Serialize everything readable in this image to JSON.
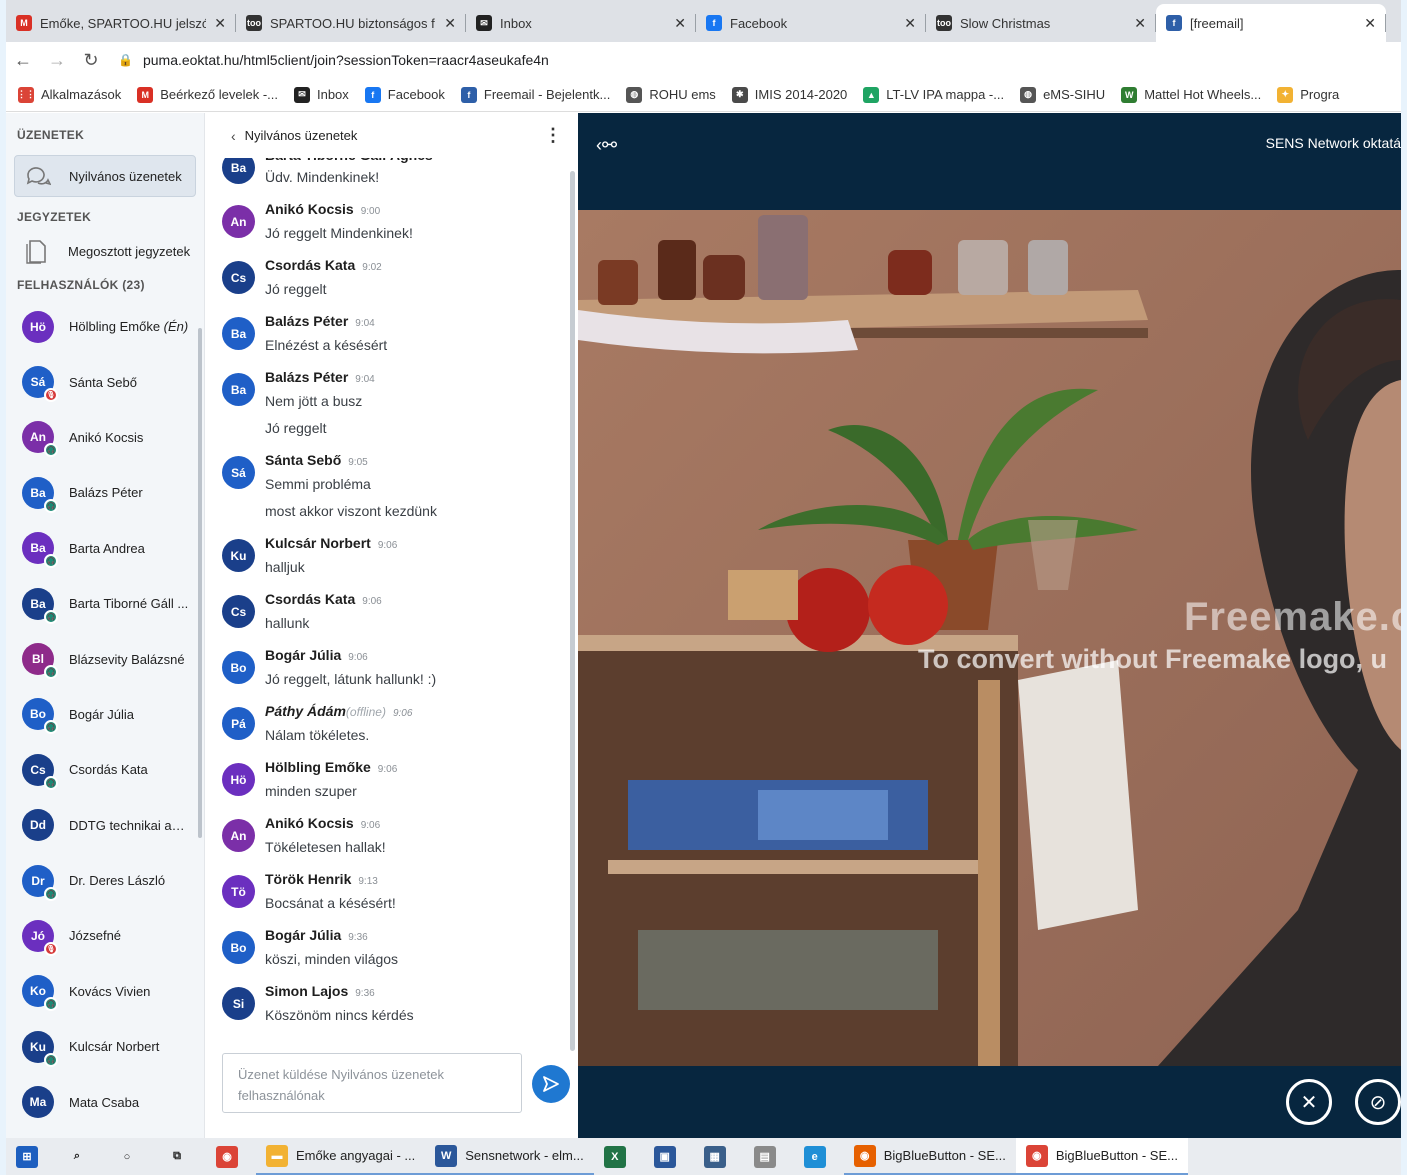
{
  "browser": {
    "tabs": [
      {
        "title": "Emőke, SPARTOO.HU jelszó",
        "icon": "gmail-icon",
        "color": "#d93025",
        "glyph": "M",
        "active": false
      },
      {
        "title": "SPARTOO.HU biztonságos f",
        "icon": "spartoo-icon",
        "color": "#333333",
        "glyph": "too",
        "active": false
      },
      {
        "title": "Inbox",
        "icon": "inbox-icon",
        "color": "#222222",
        "glyph": "✉",
        "active": false
      },
      {
        "title": "Facebook",
        "icon": "facebook-icon",
        "color": "#1877f2",
        "glyph": "f",
        "active": false
      },
      {
        "title": "Slow Christmas",
        "icon": "spartoo-icon",
        "color": "#333333",
        "glyph": "too",
        "active": false
      },
      {
        "title": "[freemail]",
        "icon": "freemail-icon",
        "color": "#2e5fa8",
        "glyph": "f",
        "active": true
      }
    ],
    "url": "puma.eoktat.hu/html5client/join?sessionToken=raacr4aseukafe4n",
    "bookmarks": [
      {
        "label": "Alkalmazások",
        "icon": "apps-icon",
        "color": "#db4437",
        "glyph": "⋮⋮"
      },
      {
        "label": "Beérkező levelek -...",
        "icon": "gmail-icon",
        "color": "#d93025",
        "glyph": "M"
      },
      {
        "label": "Inbox",
        "icon": "inbox-icon",
        "color": "#222222",
        "glyph": "✉"
      },
      {
        "label": "Facebook",
        "icon": "facebook-icon",
        "color": "#1877f2",
        "glyph": "f"
      },
      {
        "label": "Freemail - Bejelentk...",
        "icon": "freemail-icon",
        "color": "#2e5fa8",
        "glyph": "f"
      },
      {
        "label": "ROHU ems",
        "icon": "globe-icon",
        "color": "#555555",
        "glyph": "◍"
      },
      {
        "label": "IMIS 2014-2020",
        "icon": "imis-icon",
        "color": "#4a4a4a",
        "glyph": "✱"
      },
      {
        "label": "LT-LV IPA mappa -...",
        "icon": "drive-icon",
        "color": "#1fa463",
        "glyph": "▲"
      },
      {
        "label": "eMS-SIHU",
        "icon": "globe-icon",
        "color": "#555555",
        "glyph": "◍"
      },
      {
        "label": "Mattel Hot Wheels...",
        "icon": "mattel-icon",
        "color": "#2f7d32",
        "glyph": "W"
      },
      {
        "label": "Progra",
        "icon": "program-icon",
        "color": "#f2b233",
        "glyph": "✦"
      }
    ]
  },
  "sidebar": {
    "messages_heading": "ÜZENETEK",
    "public_chat": "Nyilvános üzenetek",
    "notes_heading": "JEGYZETEK",
    "shared_notes": "Megosztott jegyzetek",
    "users_heading": "FELHASZNÁLÓK (23)",
    "users": [
      {
        "initials": "Hö",
        "name": "Hölbling Emőke",
        "suffix": "(Én)",
        "color": "#6b2fbf",
        "badge": "",
        "badge_color": "#ffffff"
      },
      {
        "initials": "Sá",
        "name": "Sánta Sebő",
        "suffix": "",
        "color": "#1f5fc7",
        "badge": "🎙",
        "badge_color": "#d63a3a"
      },
      {
        "initials": "An",
        "name": "Anikó Kocsis",
        "suffix": "",
        "color": "#7b2fa8",
        "badge": "🎧",
        "badge_color": "#1a8a75"
      },
      {
        "initials": "Ba",
        "name": "Balázs Péter",
        "suffix": "",
        "color": "#1f5fc7",
        "badge": "🎧",
        "badge_color": "#1a8a75"
      },
      {
        "initials": "Ba",
        "name": "Barta Andrea",
        "suffix": "",
        "color": "#6b2fbf",
        "badge": "🎧",
        "badge_color": "#1a8a75"
      },
      {
        "initials": "Ba",
        "name": "Barta Tiborné Gáll ...",
        "suffix": "",
        "color": "#1a3f8a",
        "badge": "🎧",
        "badge_color": "#1a8a75"
      },
      {
        "initials": "Bl",
        "name": "Blázsevity Balázsné",
        "suffix": "",
        "color": "#8e2a8a",
        "badge": "🎧",
        "badge_color": "#1a8a75"
      },
      {
        "initials": "Bo",
        "name": "Bogár Júlia",
        "suffix": "",
        "color": "#1f5fc7",
        "badge": "🎧",
        "badge_color": "#1a8a75"
      },
      {
        "initials": "Cs",
        "name": "Csordás Kata",
        "suffix": "",
        "color": "#1a3f8a",
        "badge": "🎧",
        "badge_color": "#1a8a75"
      },
      {
        "initials": "Dd",
        "name": "DDTG technikai ass...",
        "suffix": "",
        "color": "#1a3f8a",
        "badge": "",
        "badge_color": "#ffffff"
      },
      {
        "initials": "Dr",
        "name": "Dr. Deres László",
        "suffix": "",
        "color": "#1f5fc7",
        "badge": "🎧",
        "badge_color": "#1a8a75"
      },
      {
        "initials": "Jó",
        "name": "Józsefné",
        "suffix": "",
        "color": "#6b2fbf",
        "badge": "🎙",
        "badge_color": "#d63a3a"
      },
      {
        "initials": "Ko",
        "name": "Kovács Vivien",
        "suffix": "",
        "color": "#1f5fc7",
        "badge": "🎧",
        "badge_color": "#1a8a75"
      },
      {
        "initials": "Ku",
        "name": "Kulcsár Norbert",
        "suffix": "",
        "color": "#1a3f8a",
        "badge": "🎧",
        "badge_color": "#1a8a75"
      },
      {
        "initials": "Ma",
        "name": "Mata Csaba",
        "suffix": "",
        "color": "#1a3f8a",
        "badge": "",
        "badge_color": "#ffffff"
      }
    ]
  },
  "chat": {
    "title": "Nyilvános üzenetek",
    "messages": [
      {
        "initials": "Ba",
        "name": "Barta Tiborné Gáll Ágnes",
        "time": "",
        "offline": "",
        "color": "#1a3f8a",
        "lines": [
          "Üdv. Mindenkinek!"
        ]
      },
      {
        "initials": "An",
        "name": "Anikó Kocsis",
        "time": "9:00",
        "offline": "",
        "color": "#7b2fa8",
        "lines": [
          "Jó reggelt Mindenkinek!"
        ]
      },
      {
        "initials": "Cs",
        "name": "Csordás Kata",
        "time": "9:02",
        "offline": "",
        "color": "#1a3f8a",
        "lines": [
          "Jó reggelt"
        ]
      },
      {
        "initials": "Ba",
        "name": "Balázs Péter",
        "time": "9:04",
        "offline": "",
        "color": "#1f5fc7",
        "lines": [
          "Elnézést a késésért"
        ]
      },
      {
        "initials": "Ba",
        "name": "Balázs Péter",
        "time": "9:04",
        "offline": "",
        "color": "#1f5fc7",
        "lines": [
          "Nem jött a busz",
          "Jó reggelt"
        ]
      },
      {
        "initials": "Sá",
        "name": "Sánta Sebő",
        "time": "9:05",
        "offline": "",
        "color": "#1f5fc7",
        "lines": [
          "Semmi probléma",
          "most akkor viszont kezdünk"
        ]
      },
      {
        "initials": "Ku",
        "name": "Kulcsár Norbert",
        "time": "9:06",
        "offline": "",
        "color": "#1a3f8a",
        "lines": [
          "halljuk"
        ]
      },
      {
        "initials": "Cs",
        "name": "Csordás Kata",
        "time": "9:06",
        "offline": "",
        "color": "#1a3f8a",
        "lines": [
          "hallunk"
        ]
      },
      {
        "initials": "Bo",
        "name": "Bogár Júlia",
        "time": "9:06",
        "offline": "",
        "color": "#1f5fc7",
        "lines": [
          "Jó reggelt, látunk hallunk! :)"
        ]
      },
      {
        "initials": "Pá",
        "name": "Páthy Ádám",
        "time": "9:06",
        "offline": "(offline)",
        "color": "#1f5fc7",
        "lines": [
          "Nálam tökéletes."
        ]
      },
      {
        "initials": "Hö",
        "name": "Hölbling Emőke",
        "time": "9:06",
        "offline": "",
        "color": "#6b2fbf",
        "lines": [
          "minden szuper"
        ]
      },
      {
        "initials": "An",
        "name": "Anikó Kocsis",
        "time": "9:06",
        "offline": "",
        "color": "#7b2fa8",
        "lines": [
          "Tökéletesen hallak!"
        ]
      },
      {
        "initials": "Tö",
        "name": "Török Henrik",
        "time": "9:13",
        "offline": "",
        "color": "#6b2fbf",
        "lines": [
          "Bocsánat a késésért!"
        ]
      },
      {
        "initials": "Bo",
        "name": "Bogár Júlia",
        "time": "9:36",
        "offline": "",
        "color": "#1f5fc7",
        "lines": [
          "köszi, minden világos"
        ]
      },
      {
        "initials": "Si",
        "name": "Simon Lajos",
        "time": "9:36",
        "offline": "",
        "color": "#1a3f8a",
        "lines": [
          "Köszönöm nincs kérdés"
        ]
      }
    ],
    "input_placeholder": "Üzenet küldése Nyilvános üzenetek felhasználónak"
  },
  "stage": {
    "title": "SENS Network oktatá",
    "watermark_logo": "Freemake.c",
    "watermark_text": "To convert without Freemake logo, u"
  },
  "taskbar": {
    "items": [
      {
        "label": "",
        "icon": "windows-start-icon",
        "color": "#1e5fbf",
        "glyph": "⊞"
      },
      {
        "label": "",
        "icon": "search-icon",
        "color": "#e9ecf0",
        "glyph": "⌕"
      },
      {
        "label": "",
        "icon": "cortana-icon",
        "color": "#e9ecf0",
        "glyph": "○"
      },
      {
        "label": "",
        "icon": "task-view-icon",
        "color": "#e9ecf0",
        "glyph": "⧉"
      },
      {
        "label": "",
        "icon": "chrome-icon",
        "color": "#db4437",
        "glyph": "◉"
      },
      {
        "label": "Emőke angyagai - ...",
        "icon": "folder-icon",
        "color": "#f2b233",
        "glyph": "▬"
      },
      {
        "label": "Sensnetwork - elm...",
        "icon": "word-icon",
        "color": "#2b579a",
        "glyph": "W"
      },
      {
        "label": "",
        "icon": "excel-icon",
        "color": "#217346",
        "glyph": "X"
      },
      {
        "label": "",
        "icon": "save-disk-icon",
        "color": "#2b579a",
        "glyph": "▣"
      },
      {
        "label": "",
        "icon": "calculator-icon",
        "color": "#3a5f8a",
        "glyph": "▦"
      },
      {
        "label": "",
        "icon": "app-icon",
        "color": "#8a8a8a",
        "glyph": "▤"
      },
      {
        "label": "",
        "icon": "edge-icon",
        "color": "#1f8fd6",
        "glyph": "e"
      },
      {
        "label": "BigBlueButton - SE...",
        "icon": "firefox-icon",
        "color": "#e66000",
        "glyph": "◉"
      },
      {
        "label": "BigBlueButton - SE...",
        "icon": "chrome-icon",
        "color": "#db4437",
        "glyph": "◉"
      }
    ]
  }
}
